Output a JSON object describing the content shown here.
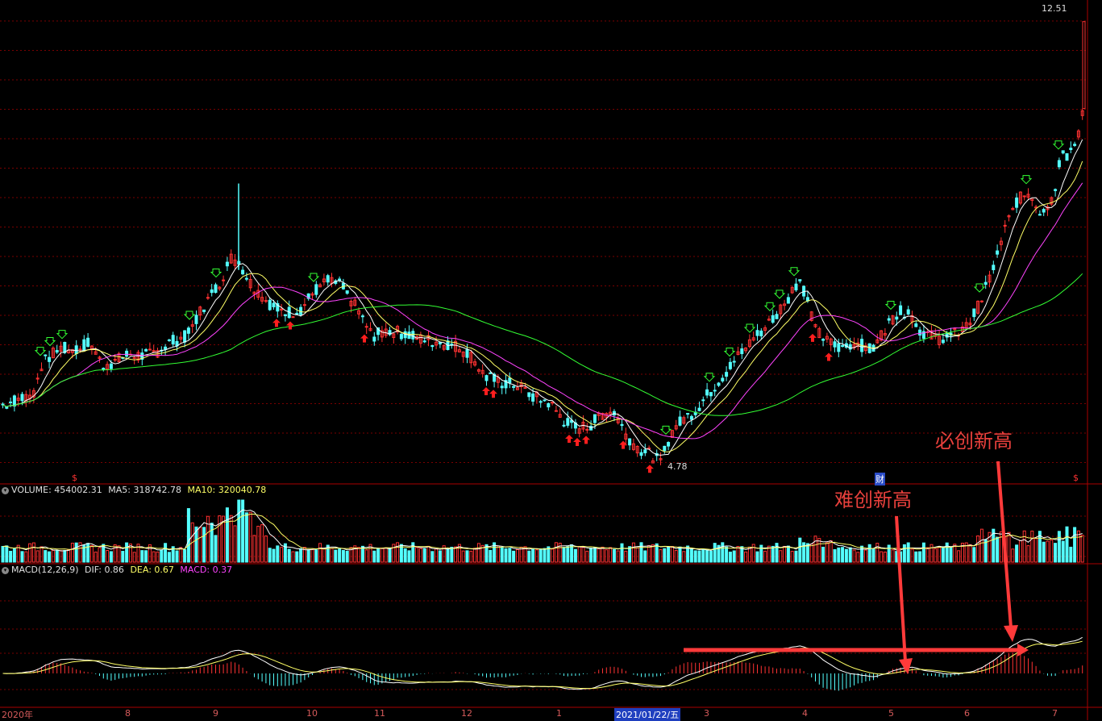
{
  "chart_data": {
    "type": "candlestick",
    "price_panel": {
      "max_label": "12.51",
      "min_label": "4.78",
      "ylim": [
        4.6,
        12.8
      ]
    },
    "volume_panel": {
      "title": "VOLUME",
      "values": [
        {
          "name": "VOLUME",
          "value": "454002.31",
          "color": "#e0e0e0"
        },
        {
          "name": "MA5",
          "value": "318742.78",
          "color": "#e0e0e0"
        },
        {
          "name": "MA10",
          "value": "320040.78",
          "color": "#ffff66"
        }
      ]
    },
    "macd_panel": {
      "title": "MACD(12,26,9)",
      "values": [
        {
          "name": "DIF",
          "value": "0.86",
          "color": "#e0e0e0"
        },
        {
          "name": "DEA",
          "value": "0.67",
          "color": "#ffff66"
        },
        {
          "name": "MACD",
          "value": "0.37",
          "color": "#ff44ff"
        }
      ]
    },
    "x_ticks": [
      "2020年",
      "8",
      "9",
      "10",
      "11",
      "12",
      "1",
      "3",
      "4",
      "5",
      "6",
      "7"
    ],
    "cursor_date": "2021/01/22/五",
    "markers": {
      "dollar": "$",
      "cai": "财"
    },
    "annotations": [
      "必创新高",
      "难创新高"
    ],
    "close_points": [
      [
        0,
        5.85
      ],
      [
        20,
        5.95
      ],
      [
        40,
        6.05
      ],
      [
        50,
        6.55
      ],
      [
        60,
        6.7
      ],
      [
        75,
        6.85
      ],
      [
        90,
        6.8
      ],
      [
        110,
        6.95
      ],
      [
        125,
        6.55
      ],
      [
        140,
        6.6
      ],
      [
        160,
        6.75
      ],
      [
        175,
        6.7
      ],
      [
        190,
        6.75
      ],
      [
        210,
        6.95
      ],
      [
        230,
        7.05
      ],
      [
        250,
        7.55
      ],
      [
        270,
        7.95
      ],
      [
        285,
        8.4
      ],
      [
        295,
        8.35
      ],
      [
        310,
        7.95
      ],
      [
        330,
        7.65
      ],
      [
        350,
        7.45
      ],
      [
        370,
        7.5
      ],
      [
        390,
        7.85
      ],
      [
        405,
        8.0
      ],
      [
        420,
        7.95
      ],
      [
        440,
        7.55
      ],
      [
        460,
        7.05
      ],
      [
        480,
        7.15
      ],
      [
        500,
        7.1
      ],
      [
        520,
        7.0
      ],
      [
        540,
        6.95
      ],
      [
        560,
        6.9
      ],
      [
        580,
        6.75
      ],
      [
        600,
        6.35
      ],
      [
        620,
        6.25
      ],
      [
        640,
        6.2
      ],
      [
        660,
        6.0
      ],
      [
        680,
        5.9
      ],
      [
        700,
        5.55
      ],
      [
        715,
        5.45
      ],
      [
        730,
        5.5
      ],
      [
        745,
        5.7
      ],
      [
        760,
        5.75
      ],
      [
        775,
        5.35
      ],
      [
        790,
        5.1
      ],
      [
        805,
        5.0
      ],
      [
        818,
        4.85
      ],
      [
        830,
        5.35
      ],
      [
        845,
        5.6
      ],
      [
        860,
        5.75
      ],
      [
        880,
        6.1
      ],
      [
        900,
        6.45
      ],
      [
        920,
        6.8
      ],
      [
        940,
        7.1
      ],
      [
        960,
        7.4
      ],
      [
        975,
        7.7
      ],
      [
        990,
        8.05
      ],
      [
        1000,
        7.7
      ],
      [
        1010,
        7.15
      ],
      [
        1025,
        6.95
      ],
      [
        1040,
        6.85
      ],
      [
        1060,
        6.95
      ],
      [
        1080,
        6.8
      ],
      [
        1095,
        7.15
      ],
      [
        1110,
        7.45
      ],
      [
        1125,
        7.5
      ],
      [
        1140,
        7.15
      ],
      [
        1160,
        7.0
      ],
      [
        1180,
        7.05
      ],
      [
        1200,
        7.25
      ],
      [
        1215,
        7.65
      ],
      [
        1230,
        8.2
      ],
      [
        1245,
        8.9
      ],
      [
        1260,
        9.4
      ],
      [
        1275,
        9.55
      ],
      [
        1290,
        9.2
      ],
      [
        1305,
        9.45
      ],
      [
        1315,
        10.3
      ],
      [
        1325,
        10.15
      ],
      [
        1335,
        10.5
      ],
      [
        1345,
        11.1
      ]
    ]
  }
}
